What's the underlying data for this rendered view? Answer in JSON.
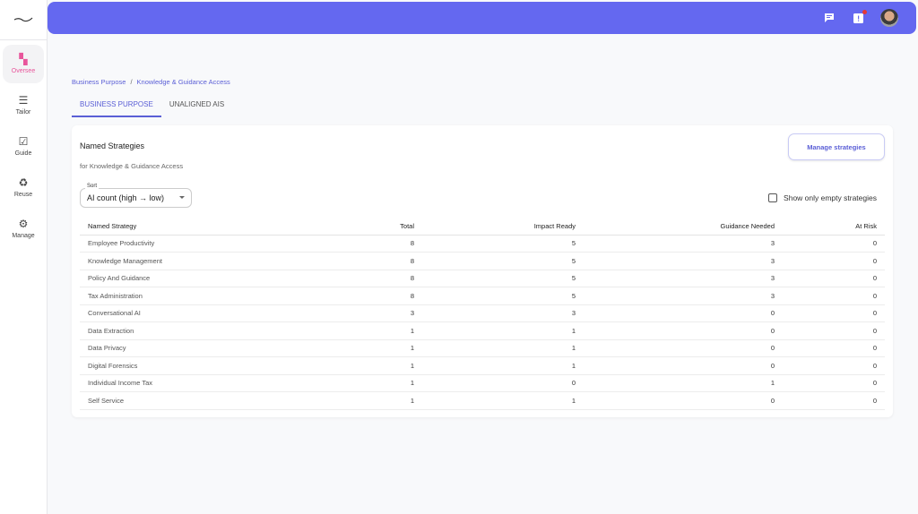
{
  "sidebar": {
    "items": [
      {
        "label": "Oversee",
        "icon": "dashboard-icon"
      },
      {
        "label": "Tailor",
        "icon": "sliders-icon"
      },
      {
        "label": "Guide",
        "icon": "checklist-icon"
      },
      {
        "label": "Reuse",
        "icon": "recycle-icon"
      },
      {
        "label": "Manage",
        "icon": "gear-icon"
      }
    ]
  },
  "breadcrumb": {
    "items": [
      "Business Purpose",
      "Knowledge & Guidance Access"
    ],
    "separator": "/"
  },
  "tabs": [
    "BUSINESS PURPOSE",
    "UNALIGNED AIS"
  ],
  "card": {
    "title": "Named Strategies",
    "subtitle": "for Knowledge & Guidance Access",
    "manage_label": "Manage strategies",
    "sort_label": "Sort",
    "sort_value": "AI count (high → low)",
    "checkbox_label": "Show only empty strategies"
  },
  "table": {
    "headers": [
      "Named Strategy",
      "Total",
      "Impact Ready",
      "Guidance Needed",
      "At Risk"
    ],
    "rows": [
      [
        "Employee Productivity",
        "8",
        "5",
        "3",
        "0"
      ],
      [
        "Knowledge Management",
        "8",
        "5",
        "3",
        "0"
      ],
      [
        "Policy And Guidance",
        "8",
        "5",
        "3",
        "0"
      ],
      [
        "Tax Administration",
        "8",
        "5",
        "3",
        "0"
      ],
      [
        "Conversational AI",
        "3",
        "3",
        "0",
        "0"
      ],
      [
        "Data Extraction",
        "1",
        "1",
        "0",
        "0"
      ],
      [
        "Data Privacy",
        "1",
        "1",
        "0",
        "0"
      ],
      [
        "Digital Forensics",
        "1",
        "1",
        "0",
        "0"
      ],
      [
        "Individual Income Tax",
        "1",
        "0",
        "1",
        "0"
      ],
      [
        "Self Service",
        "1",
        "1",
        "0",
        "0"
      ]
    ]
  },
  "colors": {
    "accent": "#6468f0",
    "active_nav": "#e8559b"
  }
}
